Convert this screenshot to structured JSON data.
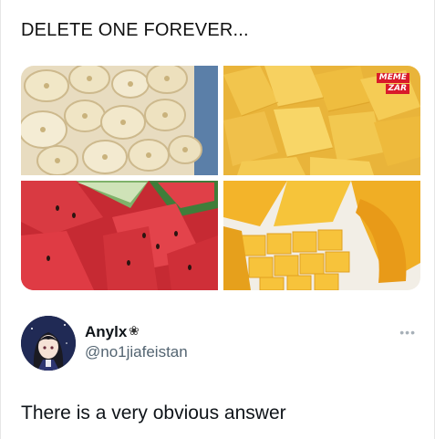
{
  "post": {
    "headline": "DELETE ONE FOREVER...",
    "images": [
      {
        "fruit": "banana"
      },
      {
        "fruit": "pineapple"
      },
      {
        "fruit": "watermelon"
      },
      {
        "fruit": "mango"
      }
    ],
    "watermark": {
      "line1": "MEME",
      "line2": "ZAR"
    }
  },
  "reply": {
    "author_name": "Anylx",
    "badge_glyph": "❀",
    "handle": "@no1jiafeistan",
    "more_glyph": "•••",
    "text": "There is a very obvious answer"
  }
}
